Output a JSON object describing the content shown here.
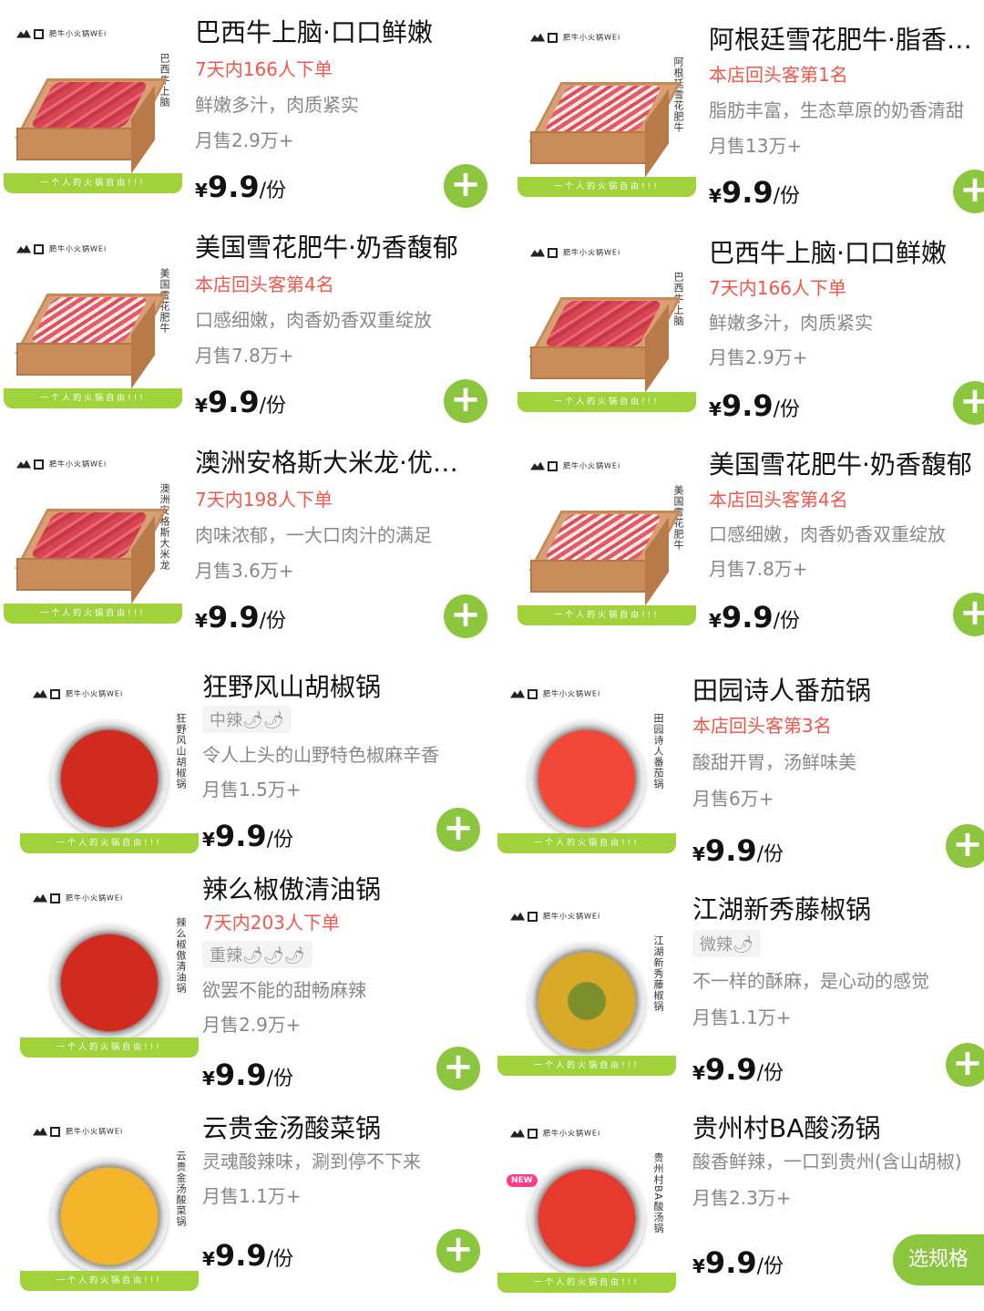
{
  "brand": {
    "name": "肥牛小火锅WEi",
    "slogan": "一个人的火锅自由!!!"
  },
  "price": {
    "currency": "¥",
    "value": "9.9",
    "unit": "/份"
  },
  "add_icon": "plus-icon",
  "colors": {
    "accent_green": "#8cc63e",
    "tag_red": "#f2564a",
    "text_gray": "#888888"
  },
  "left_beef": [
    {
      "label": "巴西牛上脑",
      "title": "巴西牛上脑·口口鲜嫩",
      "tag": "7天内166人下单",
      "desc": "鲜嫩多汁，肉质紧实",
      "sales": "月售2.9万+"
    },
    {
      "label": "美国雪花肥牛",
      "title": "美国雪花肥牛·奶香馥郁",
      "tag": "本店回头客第4名",
      "desc": "口感细嫩，肉香奶香双重绽放",
      "sales": "月售7.8万+"
    },
    {
      "label": "澳洲安格斯大米龙",
      "title": "澳洲安格斯大米龙·优…",
      "tag": "7天内198人下单",
      "desc": "肉味浓郁，一大口肉汁的满足",
      "sales": "月售3.6万+"
    }
  ],
  "right_beef": [
    {
      "label": "阿根廷雪花肥牛",
      "title": "阿根廷雪花肥牛·脂香…",
      "tag": "本店回头客第1名",
      "desc": "脂肪丰富，生态草原的奶香清甜",
      "sales": "月售13万+"
    },
    {
      "label": "巴西牛上脑",
      "title": "巴西牛上脑·口口鲜嫩",
      "tag": "7天内166人下单",
      "desc": "鲜嫩多汁，肉质紧实",
      "sales": "月售2.9万+"
    },
    {
      "label": "美国雪花肥牛",
      "title": "美国雪花肥牛·奶香馥郁",
      "tag": "本店回头客第4名",
      "desc": "口感细嫩，肉香奶香双重绽放",
      "sales": "月售7.8万+"
    }
  ],
  "left_pots": [
    {
      "label": "狂野风山胡椒锅",
      "title": "狂野风山胡椒锅",
      "spice": "中辣🌶🌶",
      "desc": "令人上头的山野特色椒麻辛香",
      "sales": "月售1.5万+"
    },
    {
      "label": "辣么椒傲清油锅",
      "title": "辣么椒傲清油锅",
      "tag": "7天内203人下单",
      "spice": "重辣🌶🌶🌶",
      "desc": "欲罢不能的甜畅麻辣",
      "sales": "月售2.9万+"
    },
    {
      "label": "云贵金汤酸菜锅",
      "title": "云贵金汤酸菜锅",
      "desc": "灵魂酸辣味，涮到停不下来",
      "sales": "月售1.1万+"
    }
  ],
  "right_pots": [
    {
      "label": "田园诗人番茄锅",
      "title": "田园诗人番茄锅",
      "tag": "本店回头客第3名",
      "desc": "酸甜开胃，汤鲜味美",
      "sales": "月售6万+"
    },
    {
      "label": "江湖新秀藤椒锅",
      "title": "江湖新秀藤椒锅",
      "spice": "微辣🌶",
      "desc": "不一样的酥麻，是心动的感觉",
      "sales": "月售1.1万+"
    },
    {
      "label": "贵州村BA酸汤锅",
      "title": "贵州村BA酸汤锅",
      "badge": "NEW",
      "desc": "酸香鲜辣，一口到贵州(含山胡椒)",
      "sales": "月售2.3万+",
      "spec_button": "选规格"
    }
  ]
}
